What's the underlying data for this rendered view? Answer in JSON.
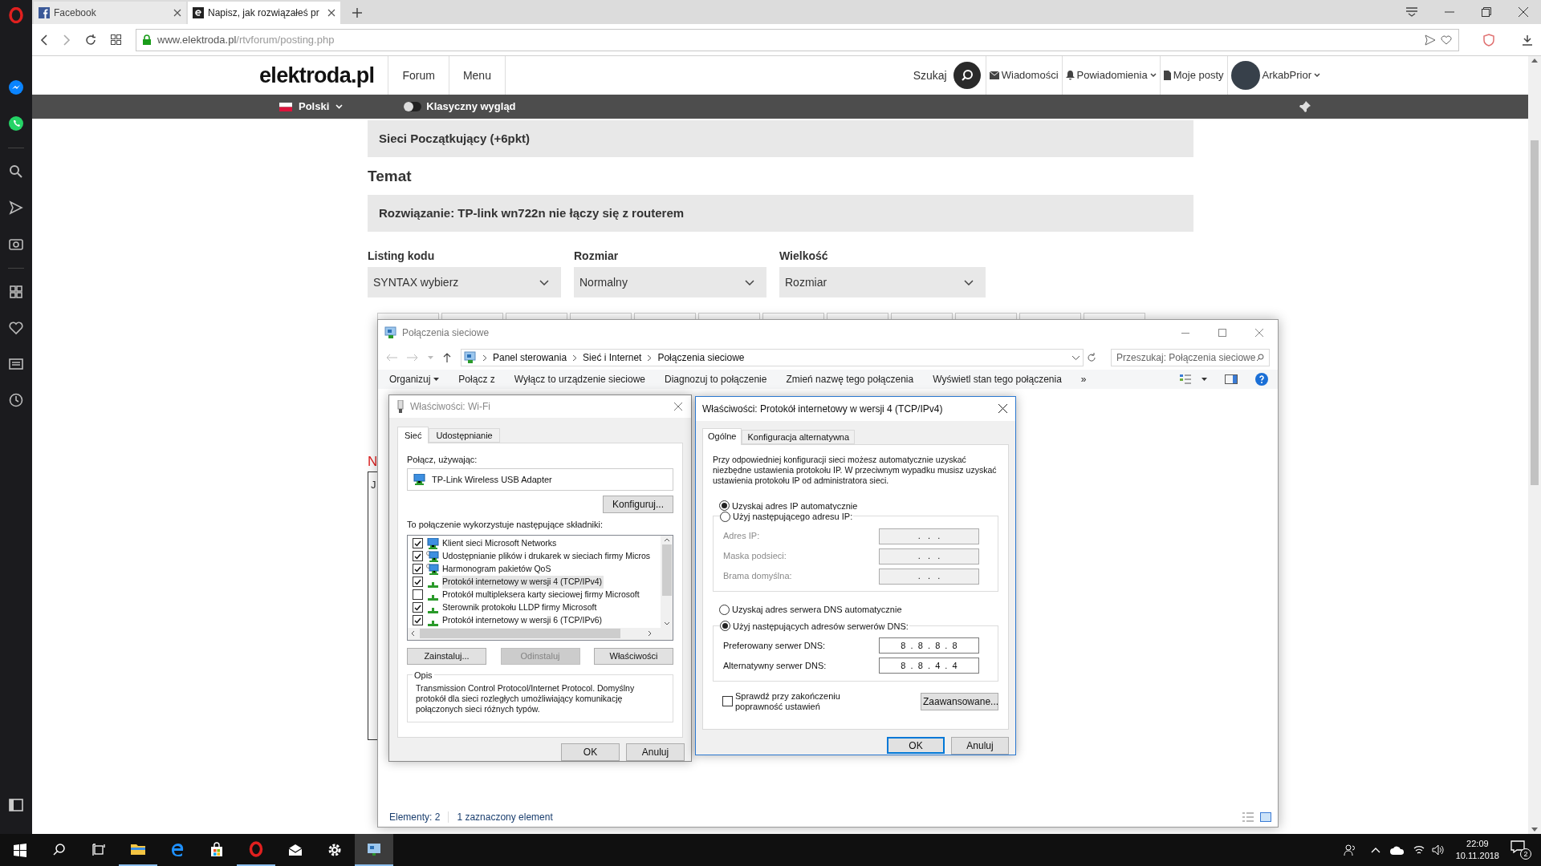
{
  "browser": {
    "tabs": [
      {
        "title": "Facebook",
        "kind": "facebook",
        "selected": false
      },
      {
        "title": "Napisz, jak rozwiązałeś pr",
        "kind": "site",
        "selected": true
      }
    ],
    "url_host": "www.elektroda.pl",
    "url_path": "/rtvforum/posting.php"
  },
  "site_header": {
    "logo": "elektroda.pl",
    "nav": [
      "Forum",
      "Menu"
    ],
    "search_label": "Szukaj",
    "links": [
      {
        "label": "Wiadomości",
        "kind": "mail"
      },
      {
        "label": "Powiadomienia",
        "kind": "bell"
      },
      {
        "label": "Moje posty",
        "kind": "doc"
      }
    ],
    "user": "ArkabPrior"
  },
  "subbar": {
    "language": "Polski",
    "classic_view": {
      "label": "Klasyczny wygląd",
      "on": false
    }
  },
  "form": {
    "category": "Sieci Początkujący (+6pkt)",
    "topic_label": "Temat",
    "topic": "Rozwiązanie: TP-link wn722n nie łączy się z routerem",
    "selects": [
      {
        "label": "Listing kodu",
        "value": "SYNTAX wybierz"
      },
      {
        "label": "Rozmiar",
        "value": "Normalny"
      },
      {
        "label": "Wielkość",
        "value": "Rozmiar"
      }
    ],
    "fragment_label": "N",
    "fragment_text": "J"
  },
  "network_window": {
    "title": "Połączenia sieciowe",
    "breadcrumb": [
      "Panel sterowania",
      "Sieć i Internet",
      "Połączenia sieciowe"
    ],
    "search_placeholder": "Przeszukaj: Połączenia sieciowe",
    "toolbar": [
      "Organizuj",
      "Połącz z",
      "Wyłącz to urządzenie sieciowe",
      "Diagnozuj to połączenie",
      "Zmień nazwę tego połączenia",
      "Wyświetl stan tego połączenia",
      "»"
    ],
    "status": [
      "Elementy: 2",
      "1 zaznaczony element"
    ]
  },
  "wifi_dialog": {
    "title": "Właściwości: Wi-Fi",
    "tabs": [
      {
        "label": "Sieć",
        "selected": true
      },
      {
        "label": "Udostępnianie",
        "selected": false
      }
    ],
    "connect_label": "Połącz, używając:",
    "adapter": "TP-Link Wireless USB Adapter",
    "configure_button": "Konfiguruj...",
    "components_label": "To połączenie wykorzystuje następujące składniki:",
    "components": [
      {
        "label": "Klient sieci Microsoft Networks",
        "kind": "client",
        "checked": true,
        "selected": false
      },
      {
        "label": "Udostępnianie plików i drukarek w sieciach firmy Micros",
        "kind": "service",
        "checked": true,
        "selected": false
      },
      {
        "label": "Harmonogram pakietów QoS",
        "kind": "service",
        "checked": true,
        "selected": false
      },
      {
        "label": "Protokół internetowy w wersji 4 (TCP/IPv4)",
        "kind": "protocol",
        "checked": true,
        "selected": true
      },
      {
        "label": "Protokół multipleksera karty sieciowej firmy Microsoft",
        "kind": "protocol",
        "checked": false,
        "selected": false
      },
      {
        "label": "Sterownik protokołu LLDP firmy Microsoft",
        "kind": "protocol",
        "checked": true,
        "selected": false
      },
      {
        "label": "Protokół internetowy w wersji 6 (TCP/IPv6)",
        "kind": "protocol",
        "checked": true,
        "selected": false
      }
    ],
    "buttons": [
      {
        "label": "Zainstaluj...",
        "disabled": false
      },
      {
        "label": "Odinstaluj",
        "disabled": true
      },
      {
        "label": "Właściwości",
        "disabled": false
      }
    ],
    "description_label": "Opis",
    "description": "Transmission Control Protocol/Internet Protocol. Domyślny protokół dla sieci rozległych umożliwiający komunikację połączonych sieci różnych typów.",
    "ok": "OK",
    "cancel": "Anuluj"
  },
  "tcp_dialog": {
    "title": "Właściwości: Protokół internetowy w wersji 4 (TCP/IPv4)",
    "tabs": [
      {
        "label": "Ogólne",
        "selected": true
      },
      {
        "label": "Konfiguracja alternatywna",
        "selected": false
      }
    ],
    "intro": "Przy odpowiedniej konfiguracji sieci możesz automatycznie uzyskać niezbędne ustawienia protokołu IP. W przeciwnym wypadku musisz uzyskać ustawienia protokołu IP od administratora sieci.",
    "ip_auto": {
      "label": "Uzyskaj adres IP automatycznie",
      "selected": true
    },
    "ip_manual": {
      "label": "Użyj następującego adresu IP:",
      "selected": false
    },
    "ip_fields": [
      {
        "label": "Adres IP:",
        "value": ".   .   .",
        "disabled": true
      },
      {
        "label": "Maska podsieci:",
        "value": ".   .   .",
        "disabled": true
      },
      {
        "label": "Brama domyślna:",
        "value": ".   .   .",
        "disabled": true
      }
    ],
    "dns_auto": {
      "label": "Uzyskaj adres serwera DNS automatycznie",
      "selected": false
    },
    "dns_manual": {
      "label": "Użyj następujących adresów serwerów DNS:",
      "selected": true
    },
    "dns_fields": [
      {
        "label": "Preferowany serwer DNS:",
        "value": "8  .  8  .  8  .  8",
        "disabled": false
      },
      {
        "label": "Alternatywny serwer DNS:",
        "value": "8  .  8  .  4  .  4",
        "disabled": false
      }
    ],
    "validate": {
      "label": "Sprawdź przy zakończeniu poprawność ustawień",
      "checked": false
    },
    "advanced_button": "Zaawansowane...",
    "ok": "OK",
    "cancel": "Anuluj"
  },
  "taskbar": {
    "time": "22:09",
    "date": "10.11.2018",
    "notifications": "2"
  }
}
